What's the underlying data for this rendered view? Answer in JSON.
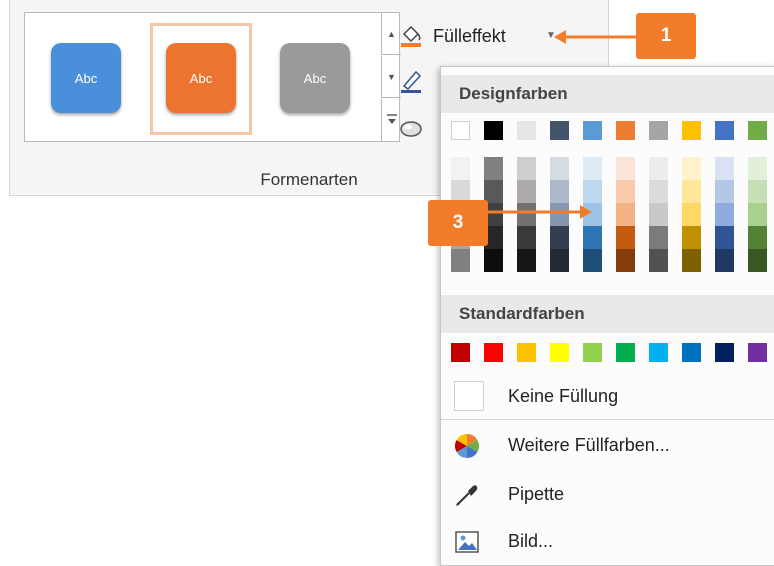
{
  "ribbon": {
    "group_label": "Formenarten",
    "styles": [
      {
        "label": "Abc",
        "color": "#4a8fd9"
      },
      {
        "label": "Abc",
        "color": "#ed7430"
      },
      {
        "label": "Abc",
        "color": "#9a9a9a"
      }
    ],
    "fill_button_label": "Fülleffekt"
  },
  "dropdown": {
    "design_colors_heading": "Designfarben",
    "standard_colors_heading": "Standardfarben",
    "theme_top_row": [
      "#ffffff",
      "#000000",
      "#e7e6e6",
      "#44546a",
      "#5b9bd5",
      "#ed7d31",
      "#a5a5a5",
      "#ffc000",
      "#4472c4",
      "#70ad47"
    ],
    "theme_shades": [
      [
        "#f2f2f2",
        "#d9d9d9",
        "#bfbfbf",
        "#a6a6a6",
        "#808080"
      ],
      [
        "#808080",
        "#595959",
        "#404040",
        "#262626",
        "#0d0d0d"
      ],
      [
        "#d0cece",
        "#aeaaaa",
        "#767171",
        "#3a3838",
        "#171616"
      ],
      [
        "#d6dce4",
        "#adb9ca",
        "#8496b0",
        "#333f4f",
        "#222a35"
      ],
      [
        "#ddebf7",
        "#bdd7ee",
        "#9dc3e6",
        "#2e75b6",
        "#1f4e79"
      ],
      [
        "#fbe5d6",
        "#f8cbad",
        "#f4b183",
        "#c55a11",
        "#843c0c"
      ],
      [
        "#ededed",
        "#dbdbdb",
        "#c9c9c9",
        "#7b7b7b",
        "#525252"
      ],
      [
        "#fff2cc",
        "#ffe699",
        "#ffd966",
        "#bf9000",
        "#7f6000"
      ],
      [
        "#d9e2f3",
        "#b4c7e7",
        "#8faadc",
        "#2f5597",
        "#203864"
      ],
      [
        "#e2f0d9",
        "#c5e0b4",
        "#a9d18e",
        "#548235",
        "#385723"
      ]
    ],
    "standard_colors": [
      "#c00000",
      "#ff0000",
      "#ffc000",
      "#ffff00",
      "#92d050",
      "#00b050",
      "#00b0f0",
      "#0070c0",
      "#002060",
      "#7030a0"
    ],
    "no_fill_label": "Keine Füllung",
    "more_colors_label": "Weitere Füllfarben...",
    "eyedropper_label": "Pipette",
    "picture_label": "Bild..."
  },
  "callouts": {
    "badge_1": "1",
    "badge_3": "3",
    "accent": "#f37c2b"
  }
}
